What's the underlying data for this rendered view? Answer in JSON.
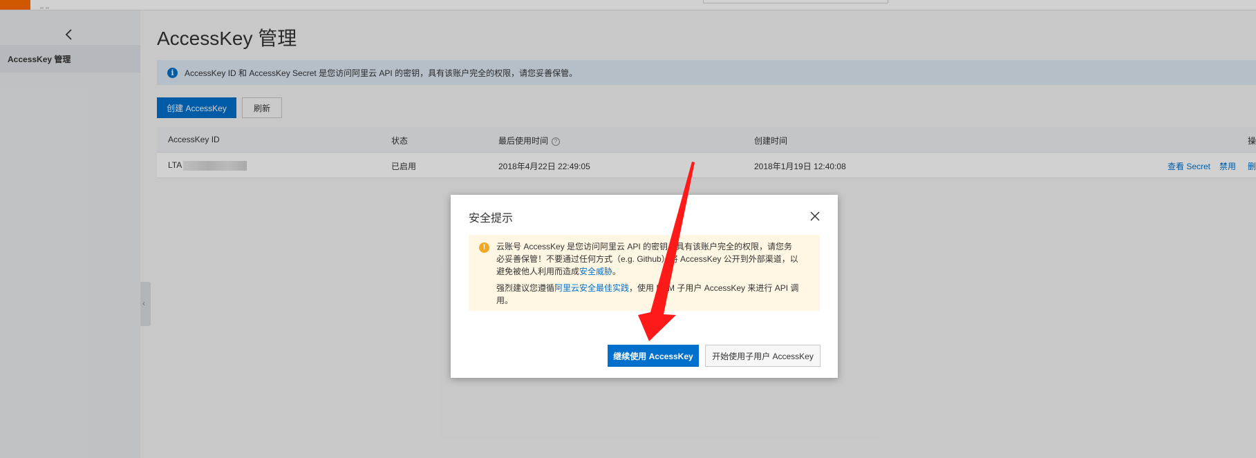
{
  "sidebar": {
    "back_icon": "chevron-left-icon",
    "items": [
      {
        "label": "AccessKey 管理"
      }
    ]
  },
  "main": {
    "title": "AccessKey 管理",
    "notice": {
      "icon": "info-icon",
      "text": "AccessKey ID 和 AccessKey Secret 是您访问阿里云 API 的密钥，具有该账户完全的权限，请您妥善保管。"
    },
    "toolbar": {
      "create_label": "创建 AccessKey",
      "refresh_label": "刷新"
    },
    "table": {
      "headers": [
        "AccessKey ID",
        "状态",
        "最后使用时间",
        "创建时间",
        "操"
      ],
      "rows": [
        {
          "id_prefix": "LTA",
          "status": "已启用",
          "last_used": "2018年4月22日 22:49:05",
          "created": "2018年1月19日 12:40:08",
          "actions": [
            "查看 Secret",
            "禁用",
            "删"
          ]
        }
      ]
    }
  },
  "dialog": {
    "title": "安全提示",
    "warning": {
      "paragraph1_parts": [
        "云账号 AccessKey 是您访问阿里云 API 的密钥，具有该账户完全的权限，请您务必妥善保管！不要通过任何方式（e.g. Github）将 AccessKey 公开到外部渠道，以避免被他人利用而造成",
        "安全威胁",
        "。"
      ],
      "paragraph2_parts": [
        "强烈建议您遵循",
        "阿里云安全最佳实践",
        "，使用 RAM 子用户 AccessKey 来进行 API 调用。"
      ]
    },
    "continue_label": "继续使用 AccessKey",
    "subuser_label": "开始使用子用户 AccessKey"
  },
  "colors": {
    "primary": "#0070cc",
    "brand": "#ff6a00",
    "annotation_arrow": "#ff1a1a",
    "warning_bg": "#fff7e3"
  }
}
